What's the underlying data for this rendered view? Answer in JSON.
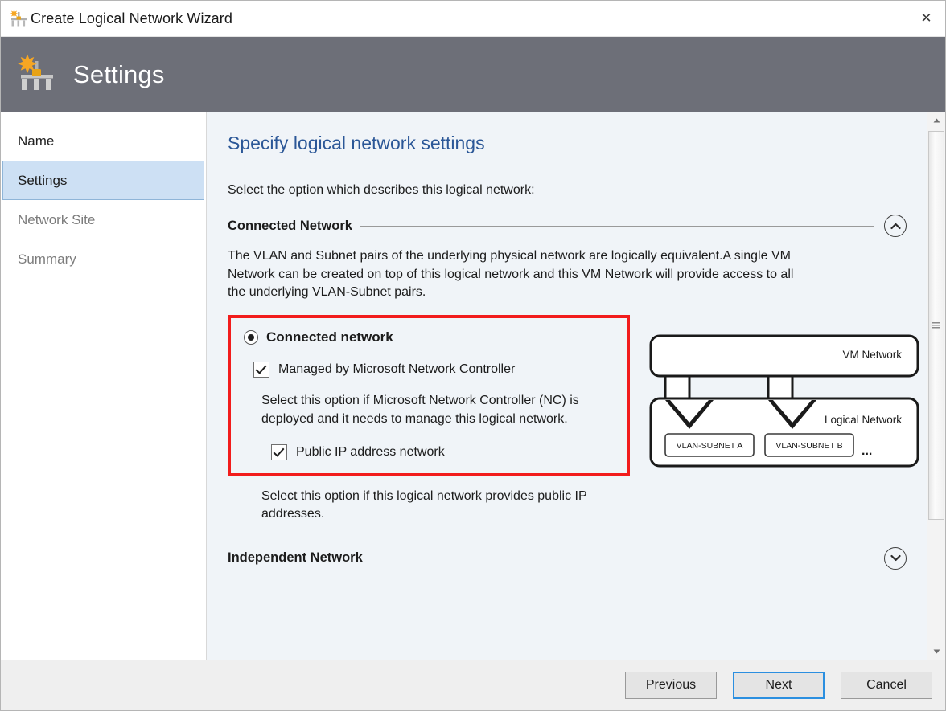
{
  "window": {
    "title": "Create Logical Network Wizard",
    "title_icon": "logical-network-wizard-icon",
    "close_label": "✕"
  },
  "banner": {
    "title": "Settings",
    "icon": "logical-network-wizard-icon",
    "background": "#6d6f78"
  },
  "sidebar": {
    "items": [
      {
        "label": "Name",
        "state": "visited"
      },
      {
        "label": "Settings",
        "state": "selected"
      },
      {
        "label": "Network Site",
        "state": "disabled"
      },
      {
        "label": "Summary",
        "state": "disabled"
      }
    ],
    "selected_background": "#cde0f4"
  },
  "main": {
    "page_title": "Specify logical network settings",
    "page_title_color": "#2b5797",
    "subtitle": "Select the option which describes this logical network:",
    "sections": [
      {
        "id": "connected-network",
        "header": "Connected Network",
        "expanded": true,
        "toggle_icon": "chevron-up-icon",
        "description": "The VLAN and Subnet pairs of the underlying physical network are logically equivalent.A single VM Network can be created on top of this logical network and this VM Network will provide access to all the underlying VLAN-Subnet pairs.",
        "option": {
          "radio_label": "Connected network",
          "radio_checked": true,
          "highlight_color": "#f21c1c",
          "checkboxes": [
            {
              "label": "Managed by Microsoft Network Controller",
              "checked": true
            },
            {
              "label": "Public IP address network",
              "checked": true
            }
          ],
          "help_text_nc": "Select this option if Microsoft Network Controller (NC) is deployed and it needs to manage this logical network.",
          "help_text_public_ip": "Select this option if this logical network provides public IP addresses."
        }
      },
      {
        "id": "independent-network",
        "header": "Independent Network",
        "expanded": false,
        "toggle_icon": "chevron-down-icon"
      }
    ]
  },
  "diagram": {
    "vm_network_label": "VM Network",
    "logical_network_label": "Logical  Network",
    "subnets": [
      "VLAN-SUBNET A",
      "VLAN-SUBNET B"
    ],
    "ellipsis": "..."
  },
  "scrollbar": {
    "up_icon": "scroll-up-arrow-icon",
    "down_icon": "scroll-down-arrow-icon",
    "thumb_icon": "scrollbar-grip-icon"
  },
  "footer": {
    "buttons": [
      {
        "label": "Previous",
        "focused": false
      },
      {
        "label": "Next",
        "focused": true
      },
      {
        "label": "Cancel",
        "focused": false
      }
    ]
  }
}
